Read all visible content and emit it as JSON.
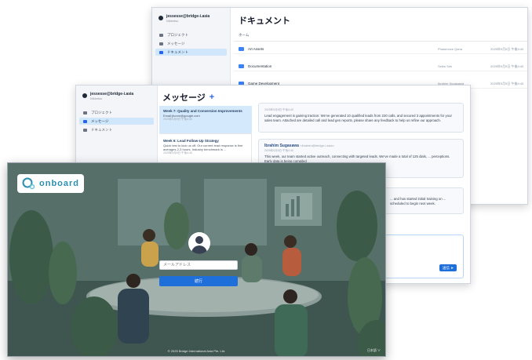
{
  "user": {
    "email": "jessesse@bridge-i.asia",
    "company": "Nikketsu"
  },
  "nav": {
    "projects": "プロジェクト",
    "messages": "メッセージ",
    "documents": "ドキュメント"
  },
  "documents": {
    "title": "ドキュメント",
    "breadcrumb": "ホーム",
    "rows": [
      {
        "name": "Art Assets",
        "owner": "Phaseonce Qana",
        "date": "2025年9月5日 午後4:40"
      },
      {
        "name": "Documentation",
        "owner": "Seles Sek",
        "date": "2025年9月5日 午後4:40"
      },
      {
        "name": "Game Development",
        "owner": "Ibrahim Sugasawa",
        "date": "2025年9月5日 午後4:40"
      }
    ]
  },
  "messages": {
    "title": "メッセージ",
    "add": "+",
    "threads": [
      {
        "title": "Week 7: Quality and Conversion Improvements",
        "preview": "Email:jhonm@google.com",
        "date": "2025年9月5日 午後4:40"
      },
      {
        "title": "Week 6: Lead Follow-Up Strategy",
        "preview": "Quick test to kick us off. Our current lead response is fine averages 2-3 hours. Industry benchmark is ...",
        "date": "2025年9月5日 午後4:40"
      }
    ],
    "card1": {
      "date": "2025年9月5日 午後4:40",
      "body": "Lead engagement is gaining traction: We've generated 10 qualified leads from 220 calls, and secured 3 appointments for your sales team. Attached are detailed call and lead gen reports, please share any feedback to help us refine our approach."
    },
    "card2": {
      "sender": "Ibrahim Sugasawa",
      "email": "<ibrahim@bridge-i.asia>",
      "date": "2025年9月5日 午後4:40",
      "body": "This week, our team started active outreach, connecting with targeted leads. We've made a total of 125 dials, ... perceptions. Early data is being compiled"
    },
    "card3": {
      "body": "... and has started initial training on ... scheduled to begin next week."
    },
    "send": "送信 ➤"
  },
  "login": {
    "brand": "onboard",
    "placeholder": "メールアドレス",
    "button": "続行",
    "footer": "© 2025 Bridge International Asia Pte. Ltd.",
    "lang": "日本語 ∨"
  },
  "colors": {
    "accent": "#1e6fd9",
    "sidebarActive": "#cfe6fb",
    "overlay": "#4f6860"
  }
}
